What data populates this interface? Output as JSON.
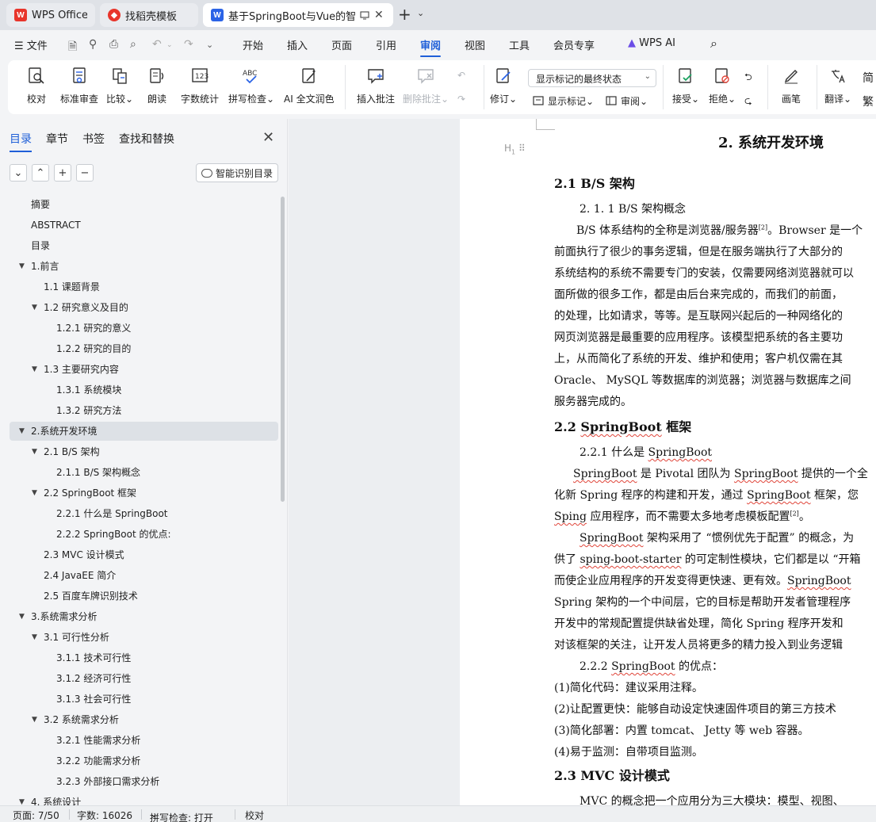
{
  "tabs": [
    {
      "label": "WPS Office",
      "icon": "wps-logo-icon",
      "color": "#e8352b"
    },
    {
      "label": "找稻壳模板",
      "icon": "docer-icon",
      "color": "#e8352b"
    },
    {
      "label": "基于SpringBoot与Vue的智能",
      "icon": "word-doc-icon",
      "color": "#2b63e6"
    }
  ],
  "menu": {
    "file": "文件",
    "items": [
      "开始",
      "插入",
      "页面",
      "引用",
      "审阅",
      "视图",
      "工具",
      "会员专享"
    ],
    "active": "审阅",
    "ai": "WPS AI"
  },
  "ribbon": {
    "proofread": "校对",
    "standard_review": "标准审查",
    "compare": "比较",
    "read_aloud": "朗读",
    "word_count": "字数统计",
    "spell_check": "拼写检查",
    "ai_polish": "AI 全文润色",
    "insert_comment": "插入批注",
    "delete_comment": "删除批注",
    "track_changes": "修订",
    "markup_display": "显示标记的最终状态",
    "show_markup": "显示标记",
    "review": "审阅",
    "accept": "接受",
    "reject": "拒绝",
    "pen": "画笔",
    "translate": "翻译",
    "simp": "简",
    "trad": "繁"
  },
  "nav": {
    "tabs": [
      "目录",
      "章节",
      "书签",
      "查找和替换"
    ],
    "active_tab": "目录",
    "smart_toc": "智能识别目录",
    "toc": [
      {
        "text": "摘要",
        "level": 0,
        "arrow": false
      },
      {
        "text": "ABSTRACT",
        "level": 0,
        "arrow": false
      },
      {
        "text": "目录",
        "level": 0,
        "arrow": false
      },
      {
        "text": "1.前言",
        "level": 0,
        "arrow": true
      },
      {
        "text": "1.1  课题背景",
        "level": 1,
        "arrow": false
      },
      {
        "text": "1.2  研究意义及目的",
        "level": 1,
        "arrow": true
      },
      {
        "text": "1.2.1  研究的意义",
        "level": 2,
        "arrow": false
      },
      {
        "text": "1.2.2  研究的目的",
        "level": 2,
        "arrow": false
      },
      {
        "text": "1.3 主要研究内容",
        "level": 1,
        "arrow": true
      },
      {
        "text": "1.3.1  系统模块",
        "level": 2,
        "arrow": false
      },
      {
        "text": "1.3.2  研究方法",
        "level": 2,
        "arrow": false
      },
      {
        "text": "2.系统开发环境",
        "level": 0,
        "arrow": true,
        "selected": true
      },
      {
        "text": "2.1 B/S 架构",
        "level": 1,
        "arrow": true
      },
      {
        "text": "2.1.1 B/S 架构概念",
        "level": 2,
        "arrow": false
      },
      {
        "text": "2.2 SpringBoot 框架",
        "level": 1,
        "arrow": true
      },
      {
        "text": "2.2.1  什么是 SpringBoot",
        "level": 2,
        "arrow": false
      },
      {
        "text": "2.2.2 SpringBoot 的优点:",
        "level": 2,
        "arrow": false
      },
      {
        "text": "2.3 MVC 设计模式",
        "level": 1,
        "arrow": false
      },
      {
        "text": "2.4 JavaEE  简介",
        "level": 1,
        "arrow": false
      },
      {
        "text": "2.5  百度车牌识别技术",
        "level": 1,
        "arrow": false
      },
      {
        "text": "3.系统需求分析",
        "level": 0,
        "arrow": true
      },
      {
        "text": "3.1  可行性分析",
        "level": 1,
        "arrow": true
      },
      {
        "text": "3.1.1  技术可行性",
        "level": 2,
        "arrow": false
      },
      {
        "text": "3.1.2  经济可行性",
        "level": 2,
        "arrow": false
      },
      {
        "text": "3.1.3  社会可行性",
        "level": 2,
        "arrow": false
      },
      {
        "text": "3.2  系统需求分析",
        "level": 1,
        "arrow": true
      },
      {
        "text": "3.2.1  性能需求分析",
        "level": 2,
        "arrow": false
      },
      {
        "text": "3.2.2  功能需求分析",
        "level": 2,
        "arrow": false
      },
      {
        "text": "3.2.3  外部接口需求分析",
        "level": 2,
        "arrow": false
      },
      {
        "text": "4.  系统设计",
        "level": 0,
        "arrow": true
      }
    ]
  },
  "doc": {
    "h1": "2. 系统开发环境",
    "h2_1": "2.1 B/S 架构",
    "h3_1": "2. 1. 1  B/S 架构概念",
    "p1": [
      "B/S 体系结构的全称是浏览器/服务器",
      "[2]",
      "。Browser 是一个",
      "前面执行了很少的事务逻辑，但是在服务端执行了大部分的",
      "系统结构的系统不需要专门的安装，仅需要网络浏览器就可以",
      "面所做的很多工作，都是由后台来完成的，而我们的前面，",
      "的处理，比如请求，等等。是互联网兴起后的一种网络化的",
      "网页浏览器是最重要的应用程序。该模型把系统的各主要功",
      "上，从而简化了系统的开发、维护和使用；客户机仅需在其",
      "Oracle、 MySQL 等数据库的浏览器；浏览器与数据库之间",
      "服务器完成的。"
    ],
    "h2_2_a": "2.2 ",
    "h2_2_b": "SpringBoot",
    "h2_2_c": " 框架",
    "h3_2_a": "2.2.1  什么是 ",
    "h3_2_b": "SpringBoot",
    "p2": [
      "SpringBoot",
      " 是  Pivotal 团队为  ",
      "SpringBoot",
      " 提供的一个全",
      "化新  Spring 程序的构建和开发，通过  ",
      "SpringBoot",
      " 框架，您",
      "Sping",
      " 应用程序，而不需要太多地考虑模板配置",
      "[2]",
      "。"
    ],
    "p3": [
      "SpringBoot",
      " 架构采用了 “惯例优先于配置” 的概念，为",
      "供了 ",
      "sping-boot-starter",
      " 的可定制性模块，它们都是以 “开箱",
      "而使企业应用程序的开发变得更快速、更有效。",
      "SpringBoot",
      "Spring 架构的一个中间层，它的目标是帮助开发者管理程序",
      "开发中的常规配置提供缺省处理，简化  Spring 程序开发和",
      "对该框架的关注，让开发人员将更多的精力投入到业务逻辑"
    ],
    "h3_3_a": "2.2.2 ",
    "h3_3_b": "SpringBoot",
    "h3_3_c": " 的优点：",
    "list": [
      "(1)简化代码：建议采用注释。",
      "(2)让配置更快：能够自动设定快速固件项目的第三方技术",
      "(3)简化部署：内置  tomcat、  Jetty 等  web 容器。",
      "(4)易于监测：自带项目监测。"
    ],
    "h2_3": "2.3 MVC 设计模式",
    "p4": "MVC 的概念把一个应用分为三大模块：模型、视图、"
  },
  "status": {
    "page": "页面: 7/50",
    "words": "字数: 16026",
    "spell": "拼写检查: 打开",
    "proof": "校对"
  }
}
